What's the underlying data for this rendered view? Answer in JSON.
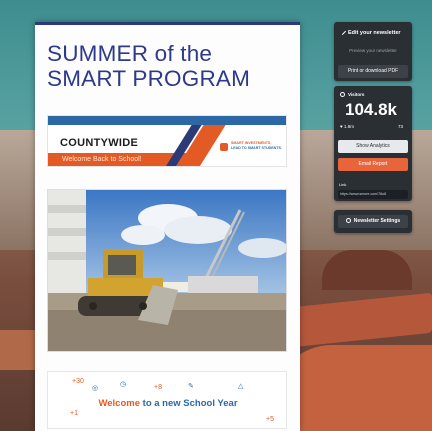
{
  "newsletter": {
    "title_line1": "SUMMER of the",
    "title_line2": "SMART PROGRAM",
    "banner": {
      "county": "COUNTYWIDE",
      "welcome": "Welcome Back to School!",
      "tagline1": "SMART INVESTMENTS,",
      "tagline2": "LEAD TO SMART STUDENTS."
    },
    "footer": {
      "welcome": "Welcome",
      "rest": "to a new School Year",
      "doodle_values": [
        "+30",
        "+8",
        "+1",
        "+5"
      ]
    }
  },
  "sidebar": {
    "edit_label": "Edit your newsletter",
    "preview_label": "Preview your newsletter",
    "print_label": "Print or download PDF",
    "visitors_label": "Visitors",
    "visitors_count": "104.8k",
    "likes_count": "1.8m",
    "likes_side": "73",
    "show_analytics_label": "Show Analytics",
    "email_report_label": "Email Report",
    "link_label": "Link",
    "link_url": "https://www.smore.com/78u8",
    "settings_label": "Newsletter Settings"
  },
  "colors": {
    "brand_navy": "#2d3a78",
    "brand_orange": "#e45a24",
    "brand_blue": "#2b68a5",
    "panel_dark": "#2a2f33"
  }
}
